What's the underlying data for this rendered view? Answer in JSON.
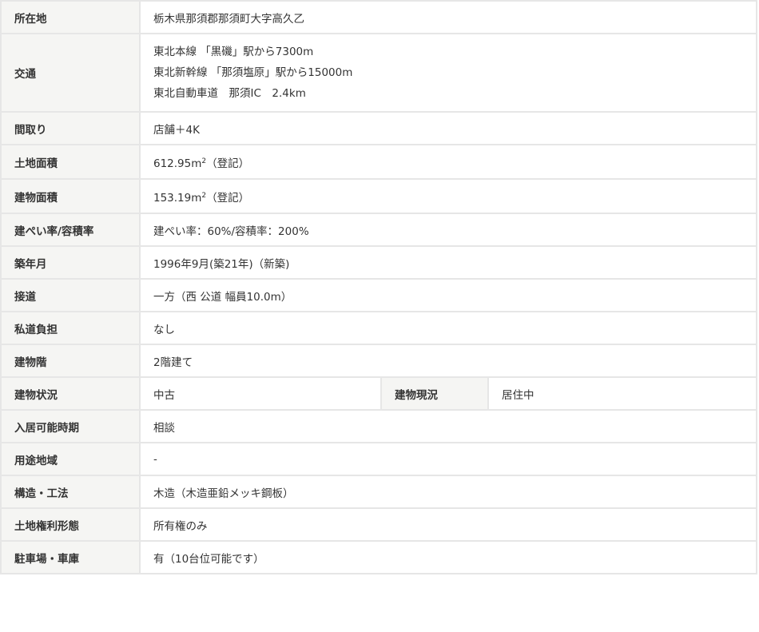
{
  "rows": {
    "location": {
      "label": "所在地",
      "value": "栃木県那須郡那須町大字高久乙"
    },
    "transport": {
      "label": "交通",
      "lines": [
        "東北本線 「黒磯」駅から7300m",
        "東北新幹線 「那須塩原」駅から15000m",
        "東北自動車道　那須IC　2.4km"
      ]
    },
    "layout": {
      "label": "間取り",
      "value": "店舗＋4K"
    },
    "land_area": {
      "label": "土地面積",
      "value": "612.95m",
      "sup": "2",
      "note": "（登記）"
    },
    "building_area": {
      "label": "建物面積",
      "value": "153.19m",
      "sup": "2",
      "note": "（登記）"
    },
    "coverage": {
      "label": "建ぺい率/容積率",
      "value": "建ぺい率：60%/容積率：200%"
    },
    "built": {
      "label": "築年月",
      "value": "1996年9月(築21年)（新築)"
    },
    "road_access": {
      "label": "接道",
      "value": "一方（西 公道 幅員10.0m）"
    },
    "private_road": {
      "label": "私道負担",
      "value": "なし"
    },
    "floors": {
      "label": "建物階",
      "value": "2階建て"
    },
    "condition": {
      "label": "建物状況",
      "value": "中古",
      "label2": "建物現況",
      "value2": "居住中"
    },
    "move_in": {
      "label": "入居可能時期",
      "value": "相談"
    },
    "zoning": {
      "label": "用途地域",
      "value": "-"
    },
    "structure": {
      "label": "構造・工法",
      "value": "木造（木造亜鉛メッキ鋼板）"
    },
    "land_rights": {
      "label": "土地権利形態",
      "value": "所有権のみ"
    },
    "parking": {
      "label": "駐車場・車庫",
      "value": "有（10台位可能です）"
    }
  }
}
